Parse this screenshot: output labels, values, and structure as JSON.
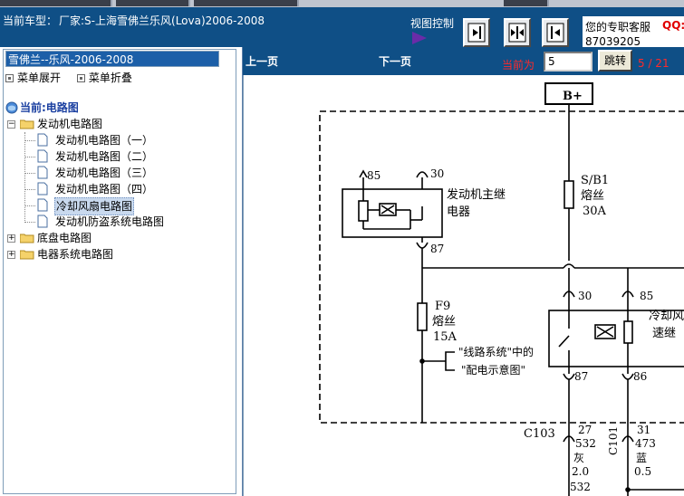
{
  "header": {
    "car_label": "当前车型：",
    "car_value": "厂家:S-上海雪佛兰乐风(Lova)2006-2008",
    "view_control": "视图控制",
    "service_label": "您的专职客服",
    "qq_label": "QQ:",
    "phone": "87039205",
    "controls": [
      "expand-right-icon",
      "split-icon",
      "collapse-left-icon"
    ]
  },
  "sidebar": {
    "car_select": "雪佛兰--乐风-2006-2008",
    "menu_expand": "菜单展开",
    "menu_collapse": "菜单折叠",
    "current_label": "当前:电路图",
    "tree": [
      {
        "label": "发动机电路图",
        "type": "folder",
        "expanded": true,
        "children": [
          {
            "label": "发动机电路图（一）"
          },
          {
            "label": "发动机电路图（二）"
          },
          {
            "label": "发动机电路图（三）"
          },
          {
            "label": "发动机电路图（四）"
          },
          {
            "label": "冷却风扇电路图",
            "selected": true
          },
          {
            "label": "发动机防盗系统电路图"
          }
        ]
      },
      {
        "label": "底盘电路图",
        "type": "folder",
        "expanded": false
      },
      {
        "label": "电器系统电路图",
        "type": "folder",
        "expanded": false
      }
    ]
  },
  "main": {
    "prev_page": "上一页",
    "next_page": "下一页",
    "current_label": "当前为",
    "page_value": "5",
    "jump_button": "跳转",
    "page_count": "5 / 21"
  },
  "diagram": {
    "bplus": "B+",
    "relay_pin_85": "85",
    "relay_pin_30": "30",
    "relay_pin_87": "87",
    "main_relay_line1": "发动机主继",
    "main_relay_line2": "电器",
    "sb1_line1": "S/B1",
    "sb1_line2": "熔丝",
    "sb1_line3": "30A",
    "f9_line1": "F9",
    "f9_line2": "熔丝",
    "f9_line3": "15A",
    "note_line1": "\"线路系统\"中的",
    "note_line2": "\"配电示意图\"",
    "fan_relay_line1": "冷却风",
    "fan_relay_line2": "速继",
    "fan_pin_30": "30",
    "fan_pin_85": "85",
    "fan_pin_87": "87",
    "fan_pin_86": "86",
    "conn_c103": "C103",
    "conn_c101": "C101",
    "pin_27": "27",
    "wire_532": "532",
    "color_grey": "灰",
    "gauge_20": "2.0",
    "pin_31": "31",
    "wire_473": "473",
    "color_blue": "蓝",
    "gauge_05": "0.5",
    "wire_532b": "532"
  }
}
